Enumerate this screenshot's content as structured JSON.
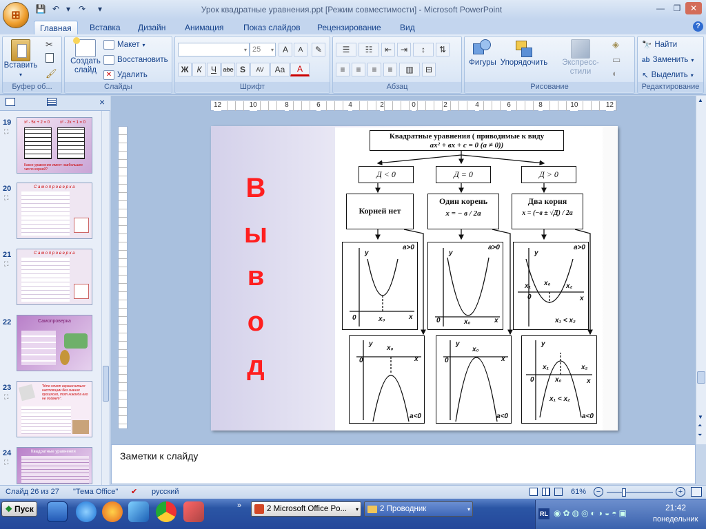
{
  "window": {
    "title": "Урок квадратные уравнения.ppt [Режим совместимости] - Microsoft PowerPoint"
  },
  "qat": {
    "save": "💾",
    "undo": "↶",
    "redo": "↷",
    "more": "▾"
  },
  "tabs": [
    "Главная",
    "Вставка",
    "Дизайн",
    "Анимация",
    "Показ слайдов",
    "Рецензирование",
    "Вид"
  ],
  "ribbon": {
    "clipboard": {
      "paste": "Вставить",
      "label": "Буфер об..."
    },
    "slides": {
      "new_slide": "Создать слайд",
      "layout": "Макет",
      "reset": "Восстановить",
      "delete": "Удалить",
      "label": "Слайды"
    },
    "font": {
      "size": "25",
      "label": "Шрифт",
      "bold": "Ж",
      "italic": "К",
      "underline": "Ч",
      "strike": "abe",
      "shadow": "S",
      "spacing": "AV",
      "case": "Aa",
      "color": "A",
      "grow": "A",
      "shrink": "A"
    },
    "paragraph": {
      "label": "Абзац"
    },
    "drawing": {
      "shapes": "Фигуры",
      "arrange": "Упорядочить",
      "quick_styles": "Экспресс-стили",
      "label": "Рисование"
    },
    "editing": {
      "find": "Найти",
      "replace": "Заменить",
      "select": "Выделить",
      "label": "Редактирование"
    }
  },
  "pane_tabs": {
    "close": "×"
  },
  "ruler": {
    "h_labels": [
      "12",
      "10",
      "8",
      "6",
      "4",
      "2",
      "0",
      "2",
      "4",
      "6",
      "8",
      "10",
      "12"
    ]
  },
  "thumbnails": [
    {
      "num": "19",
      "lines": [
        "x² - 5x + 2 = 0",
        "x² - 2x + 1 = 0"
      ],
      "caption": "Какое уравнение имеет наибольшее число корней?"
    },
    {
      "num": "20",
      "title": "С а м о п р о в е р к а"
    },
    {
      "num": "21",
      "title": "С а м о п р о в е р к а"
    },
    {
      "num": "22",
      "title": "Самопроверка"
    },
    {
      "num": "23",
      "title": "\"Кто хочет ограничиться настоящим без знания прошлого, тот никогда его не поймет\"."
    },
    {
      "num": "24",
      "title": "Квадратные уравнения"
    }
  ],
  "slide": {
    "letters": [
      "В",
      "ы",
      "в",
      "о",
      "д"
    ],
    "scheme": {
      "header_line1": "Квадратные уравнения ( приводимые к виду",
      "header_line2": "ax² + вx + c = 0 (a ≠ 0))",
      "d_neg": "Д < 0",
      "d_zero": "Д = 0",
      "d_pos": "Д > 0",
      "no_roots": "Корней нет",
      "one_root": "Один корень",
      "one_root_formula": "x = − в / 2a",
      "two_roots": "Два корня",
      "two_roots_formula": "x = (−в ± √Д) / 2a",
      "a_pos": "a>0",
      "a_neg": "a<0",
      "axis_x": "x",
      "axis_y": "y",
      "zero": "0",
      "x0": "x₀",
      "x1": "x₁",
      "x2": "x₂",
      "x1_lt_x2": "x₁ < x₂"
    }
  },
  "notes": {
    "placeholder": "Заметки к слайду"
  },
  "status": {
    "slide": "Слайд 26 из 27",
    "theme": "\"Тема Office\"",
    "language": "русский",
    "zoom": "61%"
  },
  "taskbar": {
    "start": "Пуск",
    "items": [
      "2 Microsoft Office Po...",
      "2 Проводник"
    ],
    "lang": "RL",
    "time": "21:42",
    "day": "понедельник"
  }
}
